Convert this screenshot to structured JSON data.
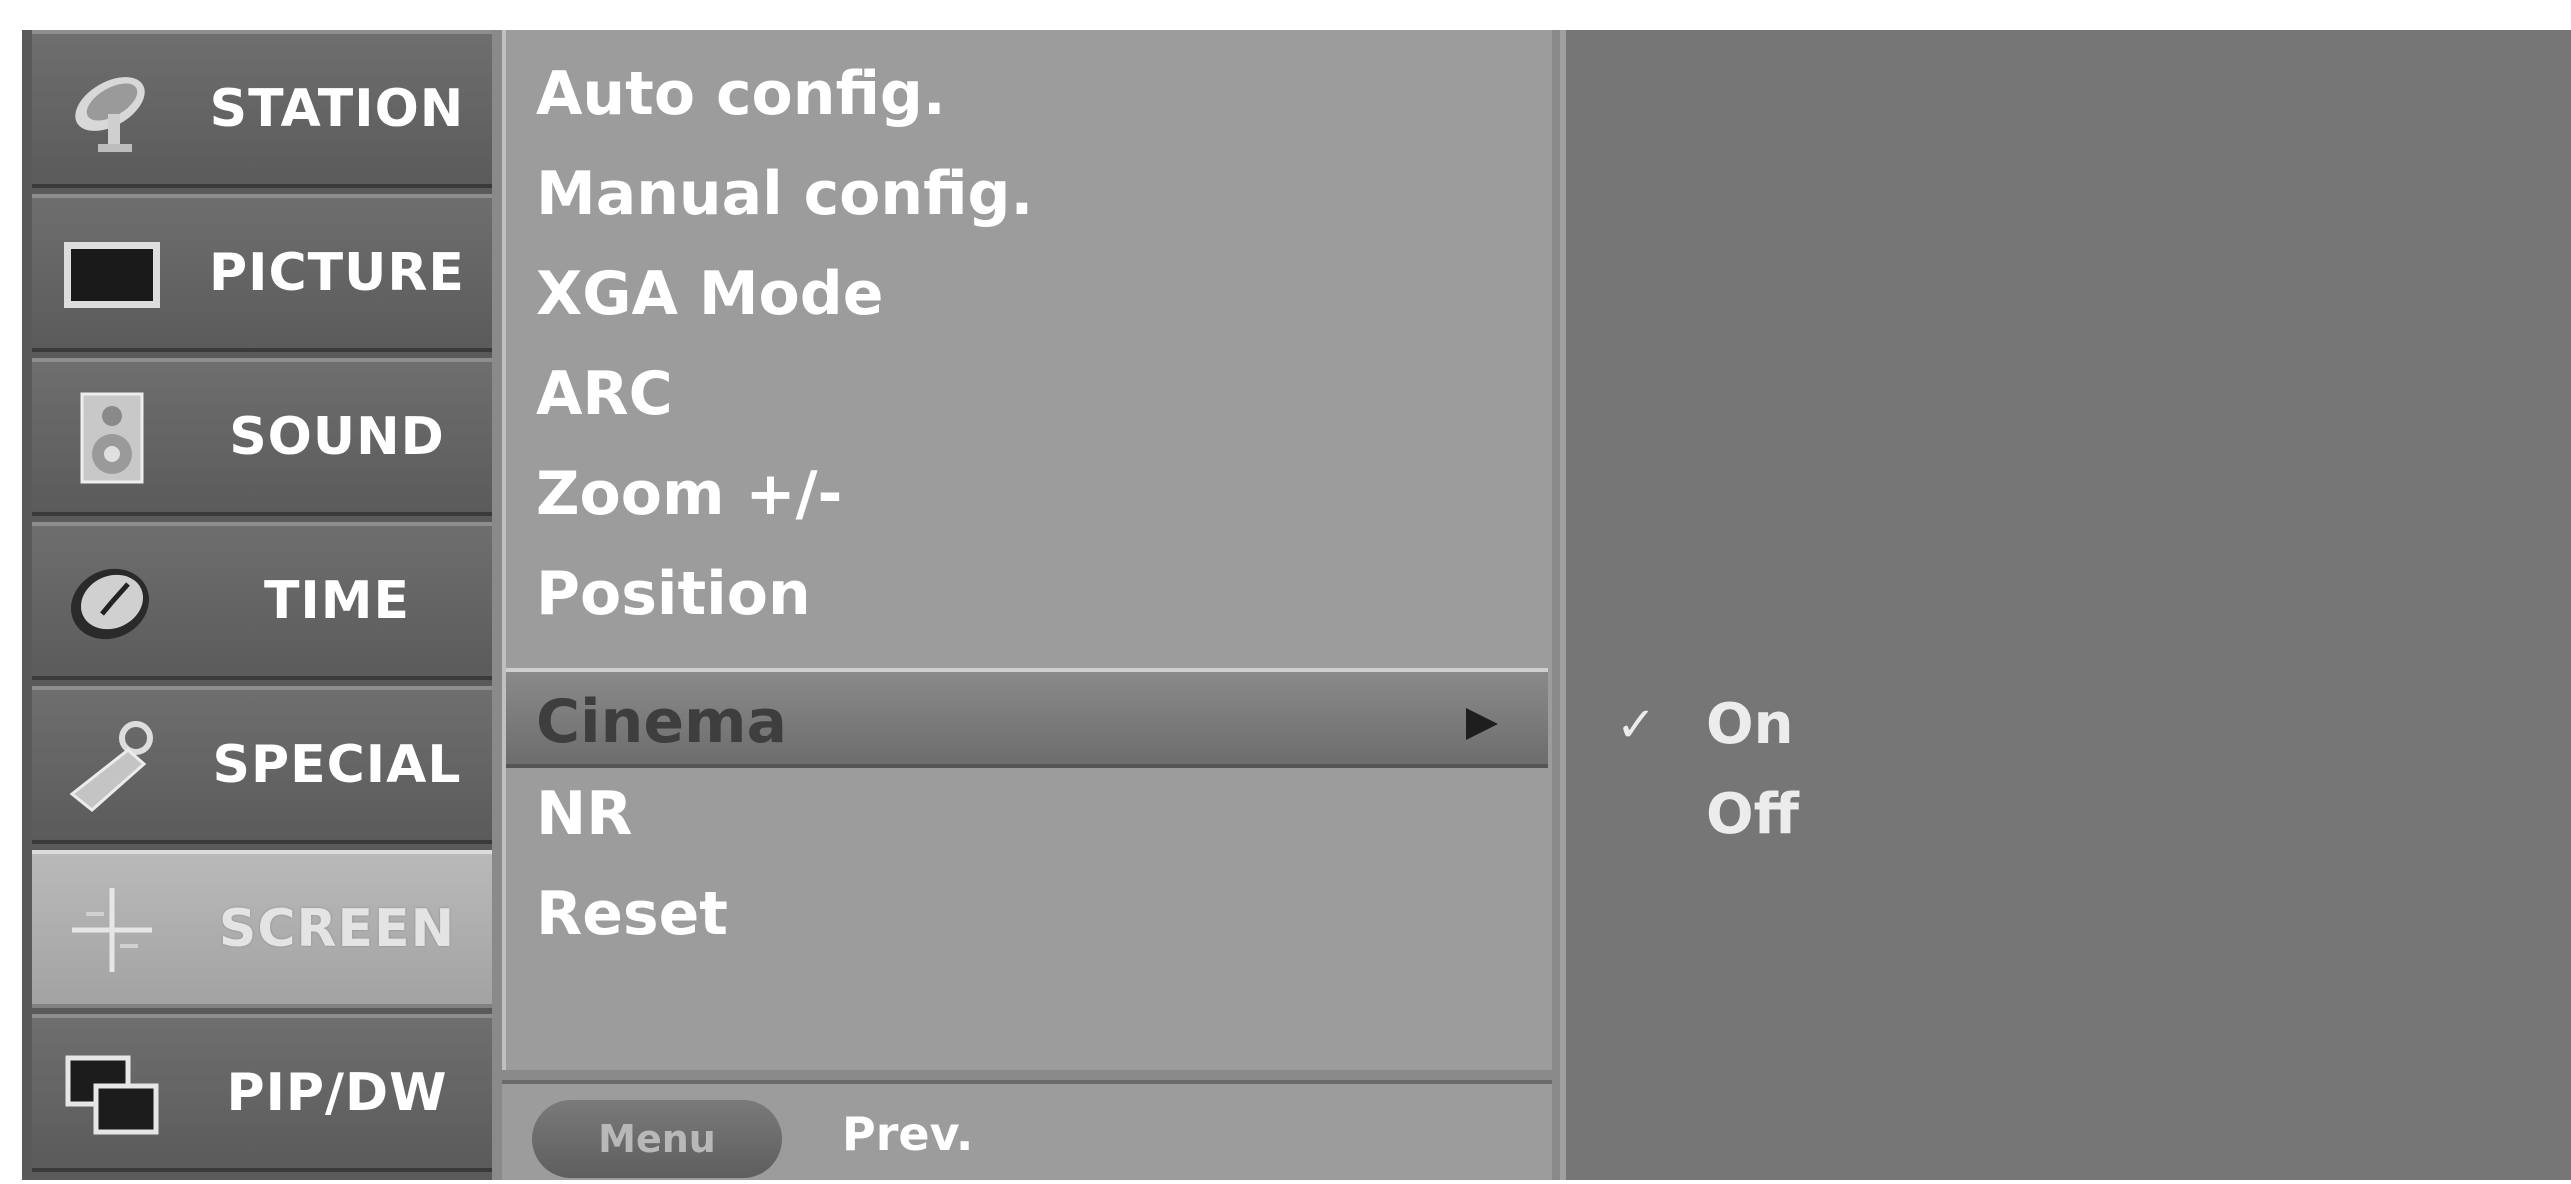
{
  "categories": [
    {
      "label": "STATION",
      "icon": "satellite-dish-icon",
      "selected": false
    },
    {
      "label": "PICTURE",
      "icon": "picture-screen-icon",
      "selected": false
    },
    {
      "label": "SOUND",
      "icon": "speaker-icon",
      "selected": false
    },
    {
      "label": "TIME",
      "icon": "clock-icon",
      "selected": false
    },
    {
      "label": "SPECIAL",
      "icon": "key-tag-icon",
      "selected": false
    },
    {
      "label": "SCREEN",
      "icon": "crosshair-icon",
      "selected": true
    },
    {
      "label": "PIP/DW",
      "icon": "pip-windows-icon",
      "selected": false
    }
  ],
  "menu": {
    "items": [
      {
        "label": "Auto config."
      },
      {
        "label": "Manual config."
      },
      {
        "label": "XGA Mode"
      },
      {
        "label": "ARC"
      },
      {
        "label": "Zoom +/-"
      },
      {
        "label": "Position"
      },
      {
        "label": "Cinema",
        "selected": true
      },
      {
        "label": "NR"
      },
      {
        "label": "Reset"
      }
    ]
  },
  "footer": {
    "button_label": "Menu",
    "hint": "Prev."
  },
  "options": {
    "items": [
      {
        "label": "On",
        "checked": true
      },
      {
        "label": "Off",
        "checked": false
      }
    ],
    "check_glyph": "✓"
  },
  "colors": {
    "selected_category": "#b0b0b0",
    "menu_background": "#9c9c9c",
    "options_background": "#767676"
  }
}
